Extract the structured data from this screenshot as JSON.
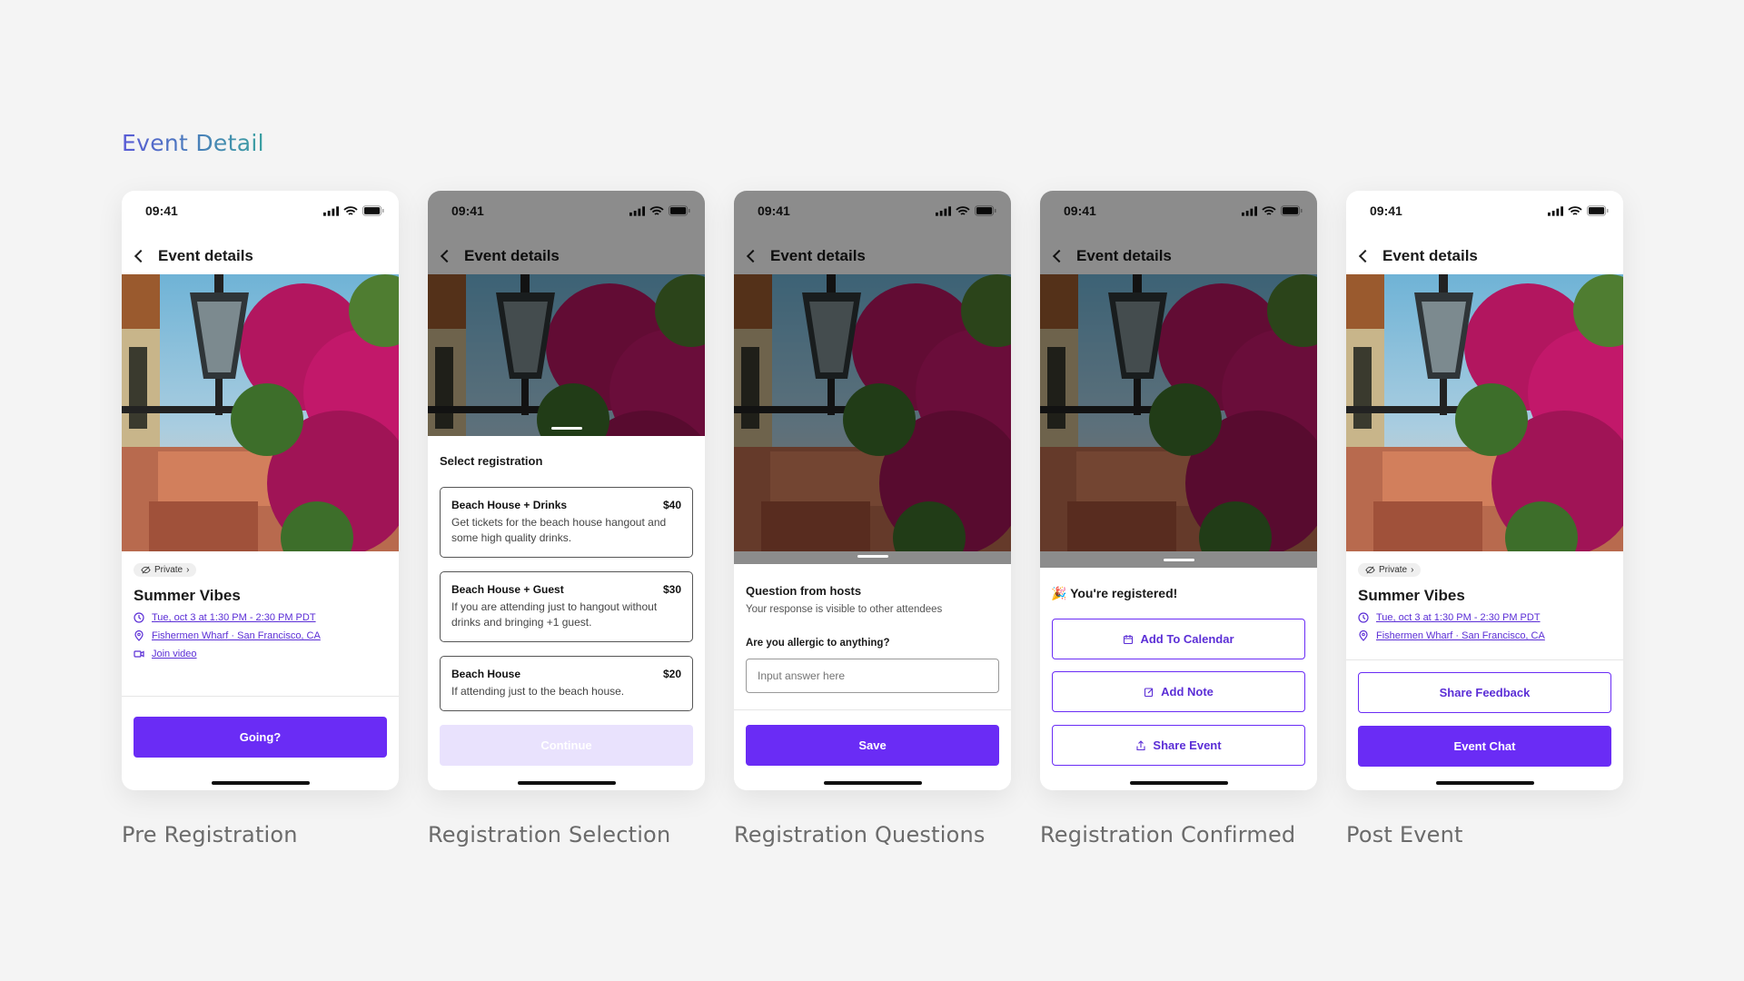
{
  "page_title": "Event Detail",
  "status_time": "09:41",
  "nav_title": "Event details",
  "event": {
    "privacy": "Private",
    "title": "Summer Vibes",
    "datetime": "Tue, oct 3 at 1:30 PM - 2:30 PM PDT",
    "location": "Fishermen Wharf · San Francisco, CA",
    "video": "Join video"
  },
  "screens": {
    "pre": {
      "caption": "Pre Registration",
      "cta": "Going?"
    },
    "selection": {
      "caption": "Registration Selection",
      "heading": "Select registration",
      "options": [
        {
          "name": "Beach House + Drinks",
          "price": "$40",
          "desc": "Get tickets for the beach house hangout and some high quality drinks."
        },
        {
          "name": "Beach House + Guest",
          "price": "$30",
          "desc": "If you are attending just to hangout without drinks and bringing +1 guest."
        },
        {
          "name": "Beach House",
          "price": "$20",
          "desc": "If attending just to the beach house."
        }
      ],
      "cta": "Continue"
    },
    "questions": {
      "caption": "Registration Questions",
      "heading": "Question from hosts",
      "subtext": "Your response is visible to other attendees",
      "question": "Are you allergic to anything?",
      "placeholder": "Input answer here",
      "cta": "Save"
    },
    "confirmed": {
      "caption": "Registration Confirmed",
      "message": "🎉 You're registered!",
      "actions": [
        "Add To Calendar",
        "Add Note",
        "Share Event"
      ]
    },
    "post": {
      "caption": "Post Event",
      "feedback": "Share Feedback",
      "chat": "Event Chat"
    }
  },
  "colors": {
    "accent": "#6a2cf5",
    "accent_light": "#e9e2fd"
  }
}
